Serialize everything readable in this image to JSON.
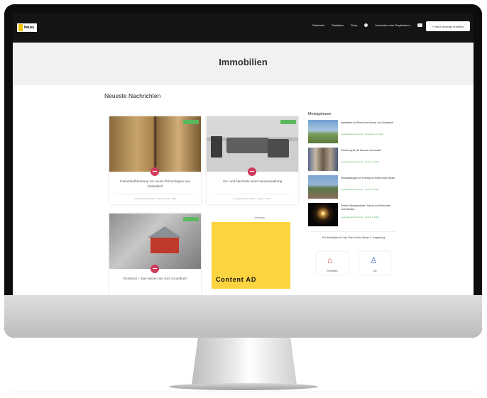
{
  "nav": {
    "logo_text": "Neuss",
    "menu": [
      "Startseite",
      "Stadtplan",
      "Shop"
    ],
    "user_label": "Anmelden oder Registrieren",
    "cta_label": "+ Neue Anzeige erstellen"
  },
  "hero": {
    "title": "Immobilien"
  },
  "main": {
    "section_title": "Neueste Nachrichten",
    "cards": [
      {
        "title": "Parkettaufbereitung mit neuen Technologien aus Düsseldorf",
        "meta": "neussdatenbank admin · Dezember 21, 2021"
      },
      {
        "title": "Vor- und Nachteile einer Hausverwaltung",
        "meta": "neussdatenbank admin · August 7, 2021"
      },
      {
        "title": "Grünbuch – Das wissen Sie zum Grundbuch",
        "meta": ""
      }
    ],
    "werbung_label": "Werbung",
    "ad_text": "Content AD"
  },
  "sidebar": {
    "title": "Meistgelesen",
    "items": [
      {
        "title": "Immobilien im Rhein-Kreis Neuss und Düsseldorf",
        "meta": "neussdatenbank admin · Dezember 21, 2021"
      },
      {
        "title": "Förderung für die Neusser Innenstadt",
        "meta": "neussdatenbank admin · Januar 3, 2022"
      },
      {
        "title": "Veranstaltungen im Frühling im Rhein-Kreis Neuss",
        "meta": "neussdatenbank admin · Januar 3, 2022"
      },
      {
        "title": "Sichere Wohngebäude: Schutz vor Einbrüchen und Bränden",
        "meta": "neussdatenbank admin · Januar 3, 2022"
      }
    ],
    "market_title": "Der Marktplatz für das Rhein-Kreis Neuss & Umgebung",
    "market_tiles": [
      {
        "label": "Immobilien",
        "icon": "house-icon"
      },
      {
        "label": "Job",
        "icon": "worker-icon"
      }
    ]
  }
}
